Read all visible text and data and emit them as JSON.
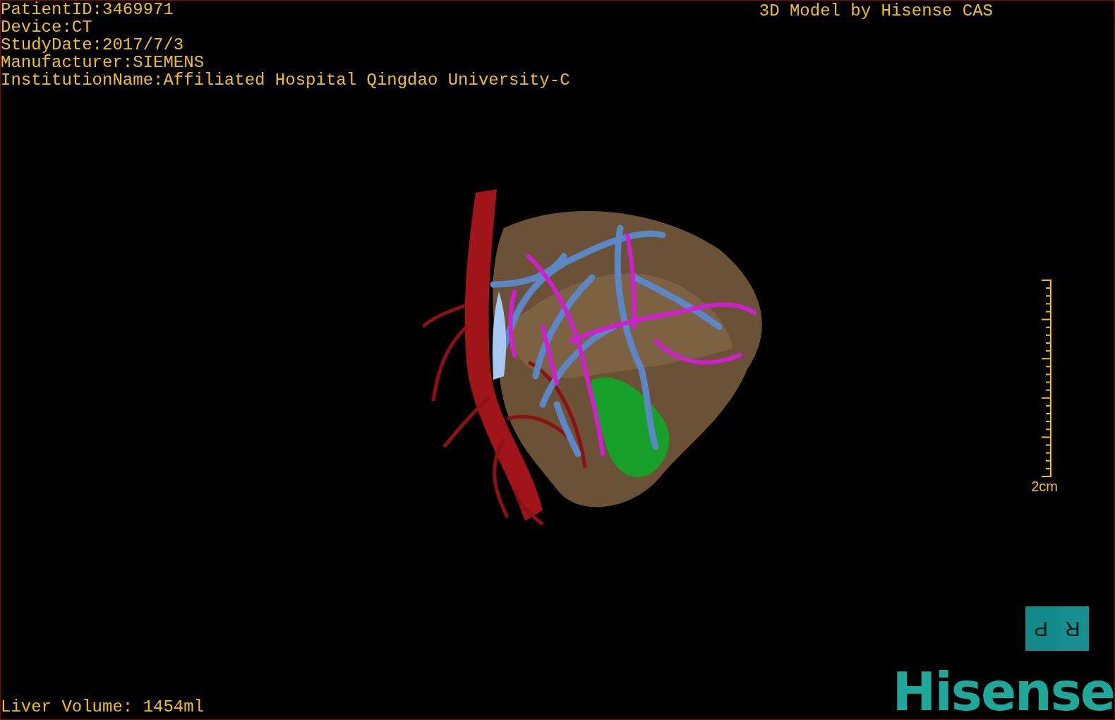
{
  "header": {
    "info_lines": [
      "PatientID:3469971",
      "Device:CT",
      "StudyDate:2017/7/3",
      "Manufacturer:SIEMENS",
      "InstitutionName:Affiliated Hospital Qingdao University-C"
    ],
    "title": "3D Model by Hisense CAS"
  },
  "viewport": {
    "scale_label": "2cm"
  },
  "orientation_cube": {
    "faces": [
      {
        "text": "P"
      },
      {
        "text": "R"
      }
    ]
  },
  "footer": {
    "liver_volume": "Liver Volume: 1454ml",
    "logo": "Hisense"
  }
}
